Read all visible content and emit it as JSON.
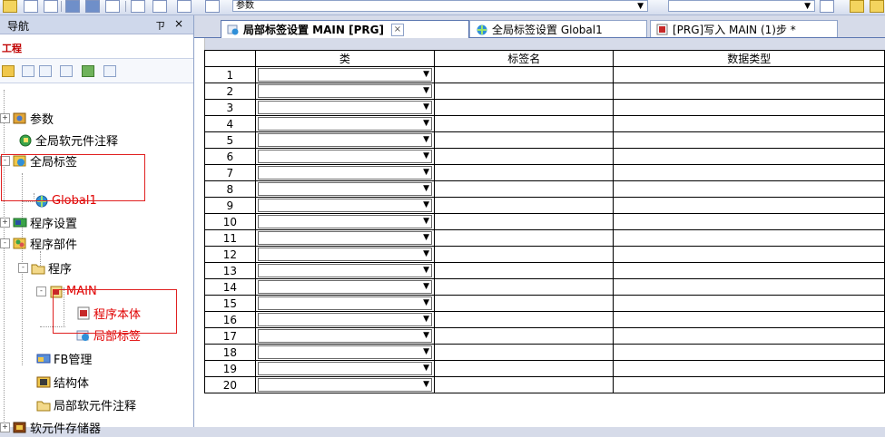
{
  "toolbar": {
    "combo_text": "参数"
  },
  "nav": {
    "title": "导航",
    "pin": "ㄗ",
    "close": "×",
    "project_label": "工程",
    "tree": [
      {
        "label": "参数",
        "expander": "+"
      },
      {
        "label": "全局软元件注释"
      },
      {
        "label": "全局标签",
        "expander": "-"
      },
      {
        "label": "Global1",
        "red": true
      },
      {
        "label": "程序设置",
        "expander": "+"
      },
      {
        "label": "程序部件",
        "expander": "-"
      },
      {
        "label": "程序",
        "expander": "-"
      },
      {
        "label": "MAIN",
        "expander": "-",
        "red": true
      },
      {
        "label": "程序本体",
        "red": true
      },
      {
        "label": "局部标签",
        "red": true
      },
      {
        "label": "FB管理"
      },
      {
        "label": "结构体"
      },
      {
        "label": "局部软元件注释"
      },
      {
        "label": "软元件存储器",
        "expander": "+"
      }
    ]
  },
  "tabs": [
    {
      "label": "局部标签设置 MAIN [PRG]",
      "active": true,
      "close": "×"
    },
    {
      "label": "全局标签设置 Global1",
      "active": false
    },
    {
      "label": "[PRG]写入 MAIN (1)步 *",
      "active": false
    }
  ],
  "grid": {
    "columns": [
      "类",
      "标签名",
      "数据类型"
    ],
    "rows": [
      "1",
      "2",
      "3",
      "4",
      "5",
      "6",
      "7",
      "8",
      "9",
      "10",
      "11",
      "12",
      "13",
      "14",
      "15",
      "16",
      "17",
      "18",
      "19",
      "20"
    ],
    "dropdown_glyph": "▼"
  }
}
